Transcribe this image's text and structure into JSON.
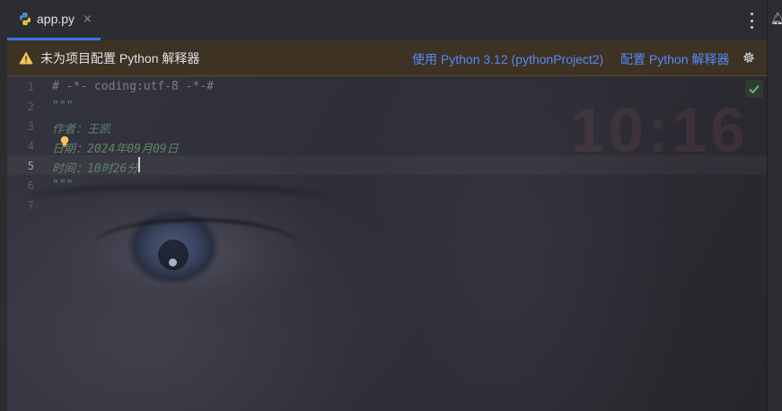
{
  "tab": {
    "label": "app.py",
    "close_glyph": "×",
    "icon": "python-icon"
  },
  "banner": {
    "message": "未为项目配置 Python 解释器",
    "link_use": "使用 Python 3.12 (pythonProject2)",
    "link_configure": "配置 Python 解释器",
    "icon": "warning-icon",
    "settings_icon": "gear-icon"
  },
  "gutter": {
    "numbers": [
      "1",
      "2",
      "3",
      "4",
      "5",
      "6",
      "7"
    ],
    "current": "5"
  },
  "code": {
    "lines": [
      "# -*- coding:utf-8 -*-#",
      "\"\"\"",
      "作者：王凯",
      "日期：2024年09月09日",
      "时间：10时26分",
      "\"\"\"",
      ""
    ]
  },
  "background_text": "10:16",
  "colors": {
    "accent": "#3574f0",
    "link": "#548af7",
    "banner_bg": "#3d3223",
    "comment": "#7a7e85",
    "docstring": "#5f826b",
    "check": "#5fb865"
  }
}
